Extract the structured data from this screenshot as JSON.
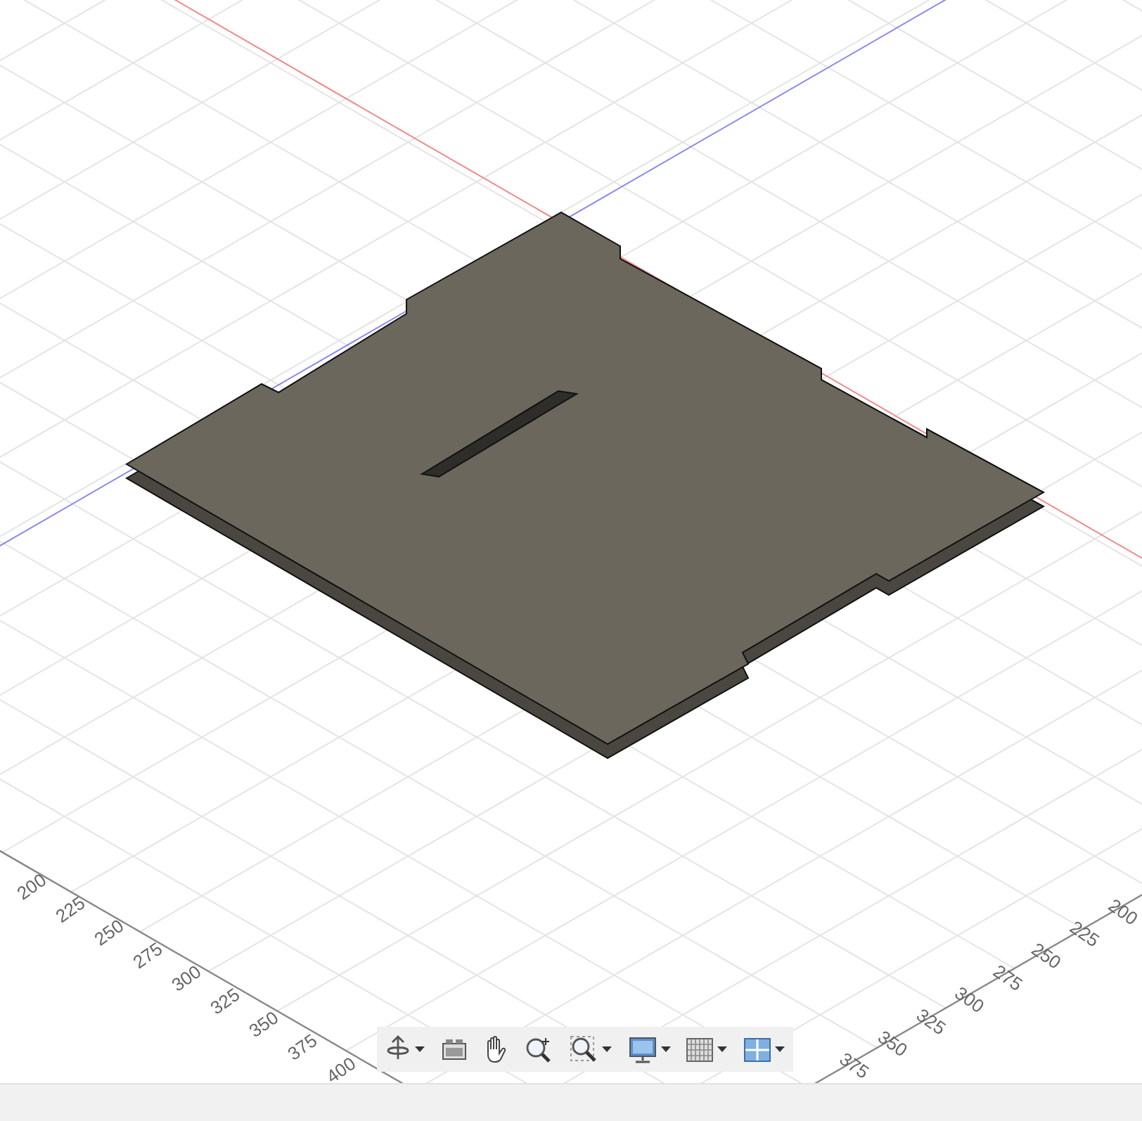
{
  "viewport": {
    "left_ruler": [
      "200",
      "225",
      "250",
      "275",
      "300",
      "325",
      "350",
      "375",
      "400"
    ],
    "right_ruler": [
      "200",
      "225",
      "250",
      "275",
      "300",
      "325",
      "350",
      "375"
    ]
  }
}
